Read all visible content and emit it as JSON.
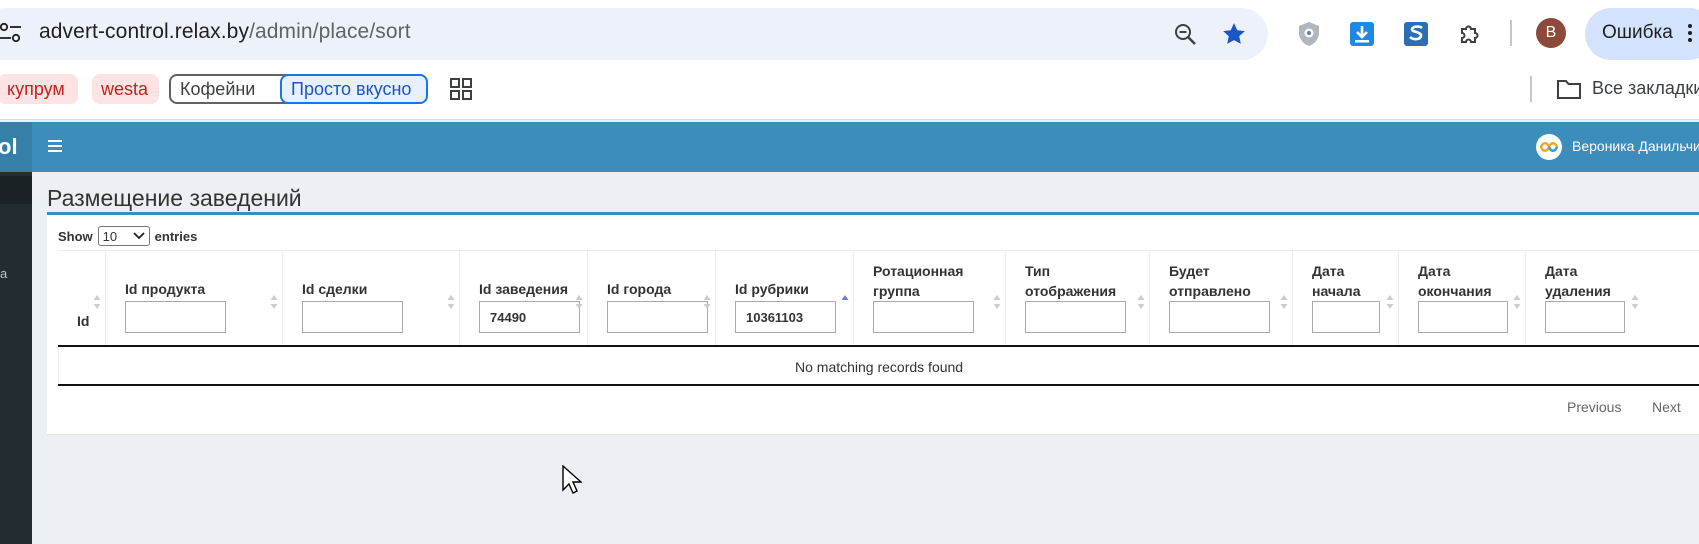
{
  "browser": {
    "url_host": "advert-control.relax.by",
    "url_path": "/admin/place/sort",
    "avatar_letter": "В",
    "error_label": "Ошибка",
    "bookmarks": [
      "купрум",
      "westa",
      "Кофейни",
      "Просто вкусно"
    ],
    "all_bookmarks": "Все закладки"
  },
  "app": {
    "brand_fragment": "ol",
    "user_name": "Вероника Данильчик",
    "accent_color": "#3c8dbc"
  },
  "page": {
    "title": "Размещение заведений",
    "show_label": "Show",
    "entries_label": "entries",
    "page_length": "10"
  },
  "table": {
    "columns": [
      {
        "label": "Id",
        "filter": null
      },
      {
        "label": "Id продукта",
        "filter": ""
      },
      {
        "label": "Id сделки",
        "filter": ""
      },
      {
        "label": "Id заведения",
        "filter": "74490"
      },
      {
        "label": "Id города",
        "filter": ""
      },
      {
        "label": "Id рубрики",
        "filter": "10361103"
      },
      {
        "label": "Ротационная группа",
        "filter": ""
      },
      {
        "label": "Тип отображения",
        "filter": ""
      },
      {
        "label": "Будет отправлено",
        "filter": ""
      },
      {
        "label": "Дата начала",
        "filter": ""
      },
      {
        "label": "Дата окончания",
        "filter": ""
      },
      {
        "label": "Дата удаления",
        "filter": ""
      }
    ],
    "empty_message": "No matching records found",
    "prev_label": "Previous",
    "next_label": "Next"
  }
}
